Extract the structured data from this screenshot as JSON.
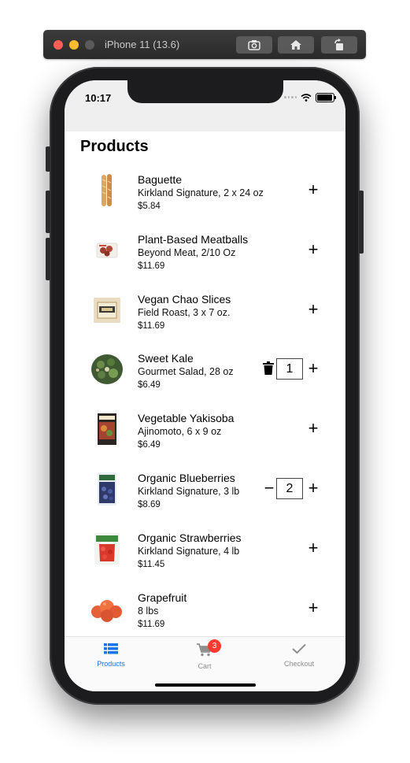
{
  "simulator": {
    "title": "iPhone 11 (13.6)"
  },
  "status_bar": {
    "time": "10:17"
  },
  "page": {
    "title": "Products"
  },
  "products": [
    {
      "name": "Baguette",
      "detail": "Kirkland Signature, 2 x 24 oz",
      "price": "$5.84",
      "quantity": null
    },
    {
      "name": "Plant-Based Meatballs",
      "detail": "Beyond Meat, 2/10 Oz",
      "price": "$11.69",
      "quantity": null
    },
    {
      "name": "Vegan Chao Slices",
      "detail": "Field Roast, 3 x 7 oz.",
      "price": "$11.69",
      "quantity": null
    },
    {
      "name": "Sweet Kale",
      "detail": "Gourmet Salad, 28 oz",
      "price": "$6.49",
      "quantity": "1"
    },
    {
      "name": "Vegetable Yakisoba",
      "detail": "Ajinomoto, 6 x 9 oz",
      "price": "$6.49",
      "quantity": null
    },
    {
      "name": "Organic Blueberries",
      "detail": "Kirkland Signature, 3 lb",
      "price": "$8.69",
      "quantity": "2"
    },
    {
      "name": "Organic Strawberries",
      "detail": "Kirkland Signature, 4 lb",
      "price": "$11.45",
      "quantity": null
    },
    {
      "name": "Grapefruit",
      "detail": "8 lbs",
      "price": "$11.69",
      "quantity": null
    }
  ],
  "controls": {
    "plus": "+",
    "minus": "−"
  },
  "tabs": [
    {
      "label": "Products",
      "icon": "list-icon",
      "active": true
    },
    {
      "label": "Cart",
      "icon": "cart-icon",
      "badge": "3"
    },
    {
      "label": "Checkout",
      "icon": "checkmark-icon"
    }
  ],
  "colors": {
    "accent": "#1a73e8",
    "badge": "#ff3b30"
  }
}
